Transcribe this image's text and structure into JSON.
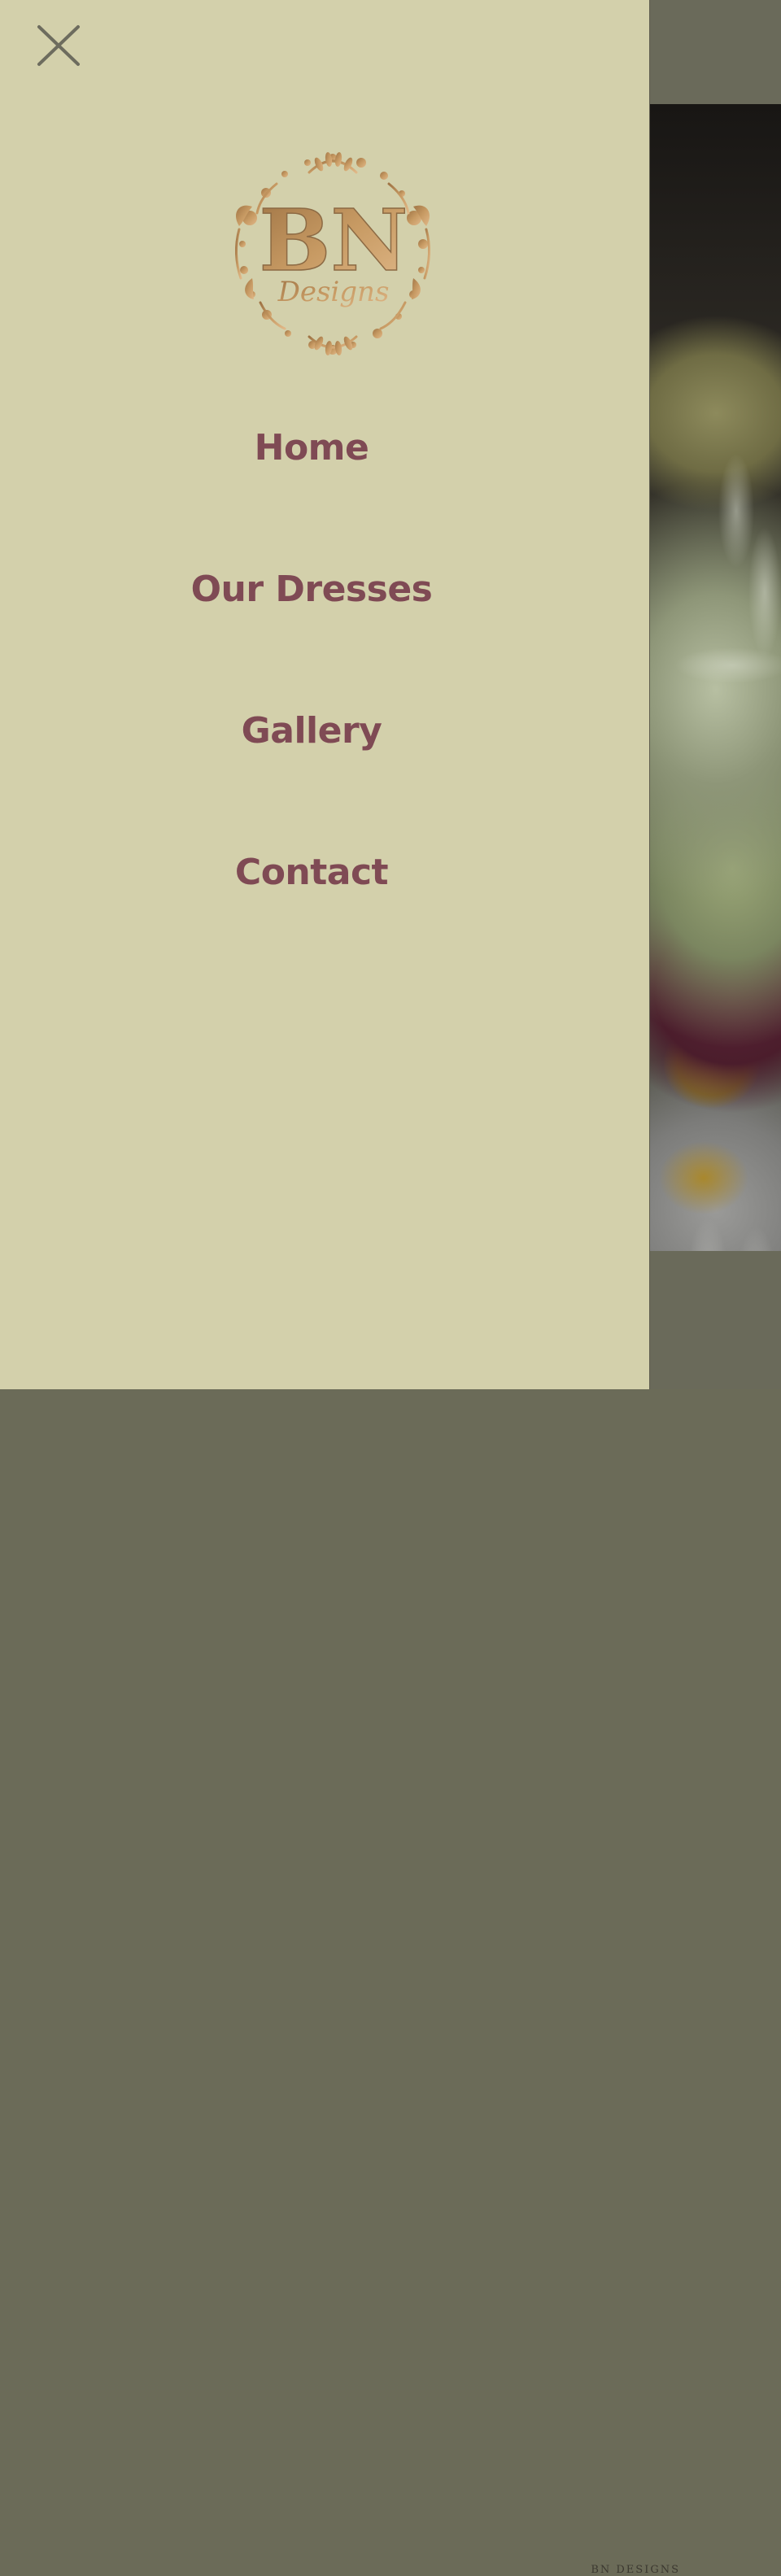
{
  "background": {
    "footer_text": "BN DESIGNS"
  },
  "drawer": {
    "close_icon": "close-icon",
    "logo": {
      "initials": "BN",
      "word": "Designs"
    },
    "nav": [
      {
        "label": "Home"
      },
      {
        "label": "Our Dresses"
      },
      {
        "label": "Gallery"
      },
      {
        "label": "Contact"
      }
    ]
  },
  "colors": {
    "drawer_bg": "#d3d0ab",
    "nav_text": "#7f4a54",
    "logo_gold": "#b58a57",
    "close_icon": "#6d6c5e",
    "overlay": "#6a6a5a"
  }
}
